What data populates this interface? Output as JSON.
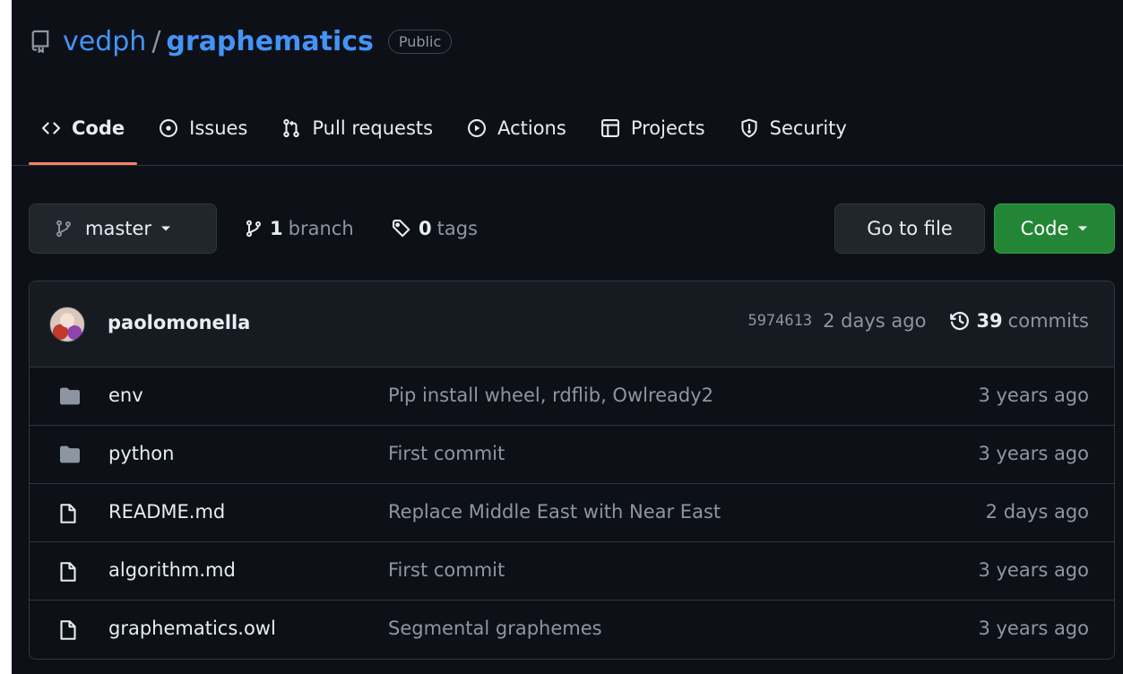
{
  "repo": {
    "owner": "vedph",
    "separator": "/",
    "name": "graphematics",
    "visibility": "Public"
  },
  "nav": {
    "tabs": [
      {
        "label": "Code",
        "icon": "code-icon",
        "active": true
      },
      {
        "label": "Issues",
        "icon": "issue-opened-icon"
      },
      {
        "label": "Pull requests",
        "icon": "git-pull-request-icon"
      },
      {
        "label": "Actions",
        "icon": "play-icon"
      },
      {
        "label": "Projects",
        "icon": "table-icon"
      },
      {
        "label": "Security",
        "icon": "shield-icon"
      }
    ]
  },
  "toolbar": {
    "branch_label": "master",
    "branches_count": "1",
    "branches_label": "branch",
    "tags_count": "0",
    "tags_label": "tags",
    "goto_file_label": "Go to file",
    "code_label": "Code"
  },
  "latest_commit": {
    "author": "paolomonella",
    "sha": "5974613",
    "time": "2 days ago",
    "commits_count": "39",
    "commits_label": "commits"
  },
  "files": [
    {
      "name": "env",
      "type": "dir",
      "message": "Pip install wheel, rdflib, Owlready2",
      "age": "3 years ago"
    },
    {
      "name": "python",
      "type": "dir",
      "message": "First commit",
      "age": "3 years ago"
    },
    {
      "name": "README.md",
      "type": "file",
      "message": "Replace Middle East with Near East",
      "age": "2 days ago"
    },
    {
      "name": "algorithm.md",
      "type": "file",
      "message": "First commit",
      "age": "3 years ago"
    },
    {
      "name": "graphematics.owl",
      "type": "file",
      "message": "Segmental graphemes",
      "age": "3 years ago"
    }
  ],
  "colors": {
    "background": "#0d1117",
    "link": "#4493f8",
    "muted": "#8d96a0",
    "accent_underline": "#f78166",
    "primary_button": "#238636"
  }
}
